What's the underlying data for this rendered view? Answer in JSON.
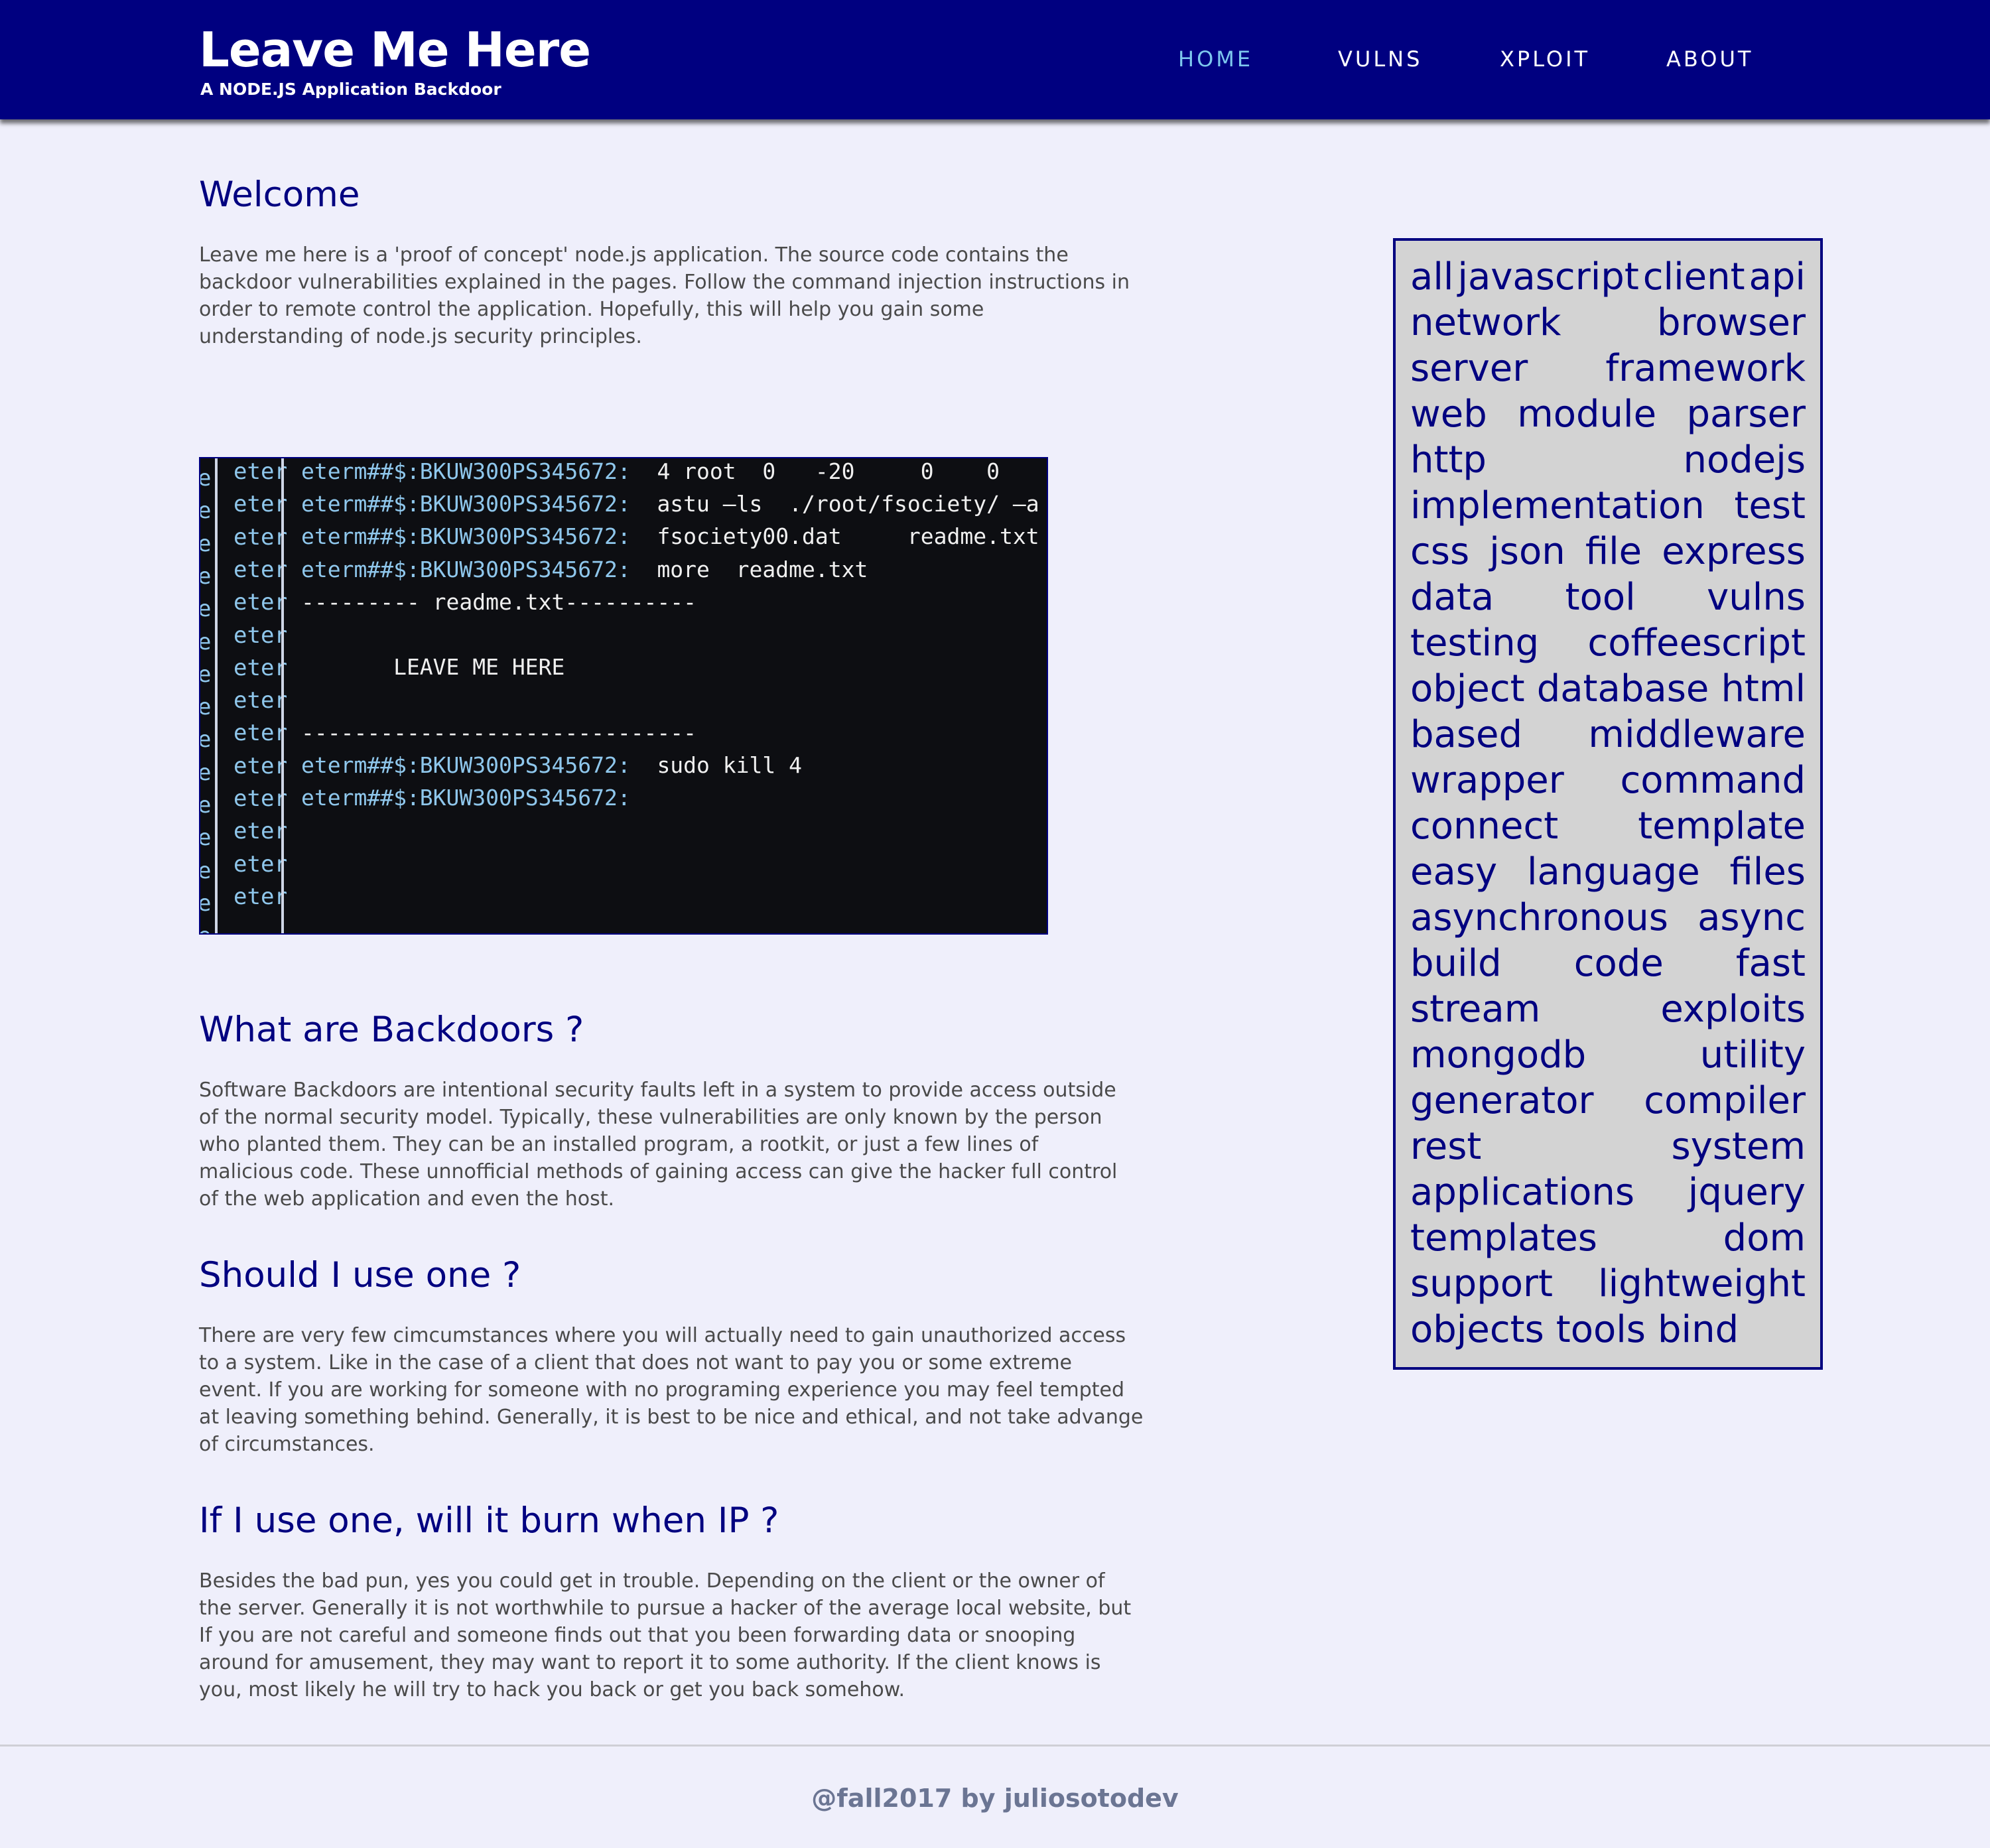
{
  "header": {
    "title": "Leave Me Here",
    "tagline": "A NODE.JS Application Backdoor",
    "nav": [
      {
        "label": "HOME",
        "active": true
      },
      {
        "label": "VULNS",
        "active": false
      },
      {
        "label": "XPLOIT",
        "active": false
      },
      {
        "label": "ABOUT",
        "active": false
      }
    ]
  },
  "main": {
    "welcome": {
      "heading": "Welcome",
      "lines": [
        "Leave me here is a 'proof of concept' node.js application. The source code contains the",
        "backdoor vulnerabilities explained in the pages. Follow the command injection instructions in",
        "order to remote control the application. Hopefully, this will help you gain some",
        "understanding of node.js security principles."
      ]
    },
    "backdoors": {
      "heading": "What are Backdoors ?",
      "lines": [
        "Software Backdoors are intentional security faults left in a system to provide access outside",
        "of the normal security model. Typically, these vulnerabilities are only known by the person",
        "who planted them. They can be an installed program, a rootkit, or just a few lines of",
        "malicious code. These unnofficial methods of gaining access can give the hacker full control",
        "of the web application and even the host."
      ]
    },
    "should_use": {
      "heading": "Should I use one ?",
      "lines": [
        "There are very few cimcumstances where you will actually need to gain unauthorized access",
        "to a system. Like in the case of a client that does not want to pay you or some extreme",
        "event. If you are working for someone with no programing experience you may feel tempted",
        "at leaving something behind. Generally, it is best to be nice and ethical, and not take advange",
        "of circumstances."
      ]
    },
    "burn": {
      "heading": "If I use one, will it burn when IP ?",
      "lines": [
        "Besides the bad pun, yes you could get in trouble. Depending on the client or the owner of",
        "the server. Generally it is not worthwhile to pursue a hacker of the average local website, but",
        "If you are not careful and someone finds out that you been forwarding data or snooping",
        "around for amusement, they may want to report it to some authority. If the client knows is",
        "you, most likely he will try to hack you back or get you back somehow."
      ]
    }
  },
  "terminal": {
    "gutter_left": "e",
    "gutter_word": "eter",
    "lines": [
      {
        "prompt": "eterm##$:BKUW300PS345672:",
        "text": "  4 root  0   -20     0    0"
      },
      {
        "prompt": "eterm##$:BKUW300PS345672:",
        "text": "  astu –ls  ./root/fsociety/ –a"
      },
      {
        "prompt": "eterm##$:BKUW300PS345672:",
        "text": "  fsociety00.dat     readme.txt"
      },
      {
        "prompt": "eterm##$:BKUW300PS345672:",
        "text": "  more  readme.txt"
      },
      {
        "prompt": "",
        "text": "--------- readme.txt----------"
      },
      {
        "prompt": "",
        "text": ""
      },
      {
        "prompt": "",
        "text": "       LEAVE ME HERE"
      },
      {
        "prompt": "",
        "text": ""
      },
      {
        "prompt": "",
        "text": "------------------------------"
      },
      {
        "prompt": "eterm##$:BKUW300PS345672:",
        "text": "  sudo kill 4"
      },
      {
        "prompt": "eterm##$:BKUW300PS345672:",
        "text": ""
      }
    ]
  },
  "tagcloud": {
    "rows": [
      [
        "all",
        "javascript",
        "client",
        "api"
      ],
      [
        "network",
        "browser"
      ],
      [
        "server",
        "framework"
      ],
      [
        "web",
        "module",
        "parser"
      ],
      [
        "http",
        "nodejs"
      ],
      [
        "implementation",
        "test"
      ],
      [
        "css",
        "json",
        "file",
        "express"
      ],
      [
        "data",
        "tool",
        "vulns"
      ],
      [
        "testing",
        "coffeescript"
      ],
      [
        "object",
        "database",
        "html"
      ],
      [
        "based",
        "middleware"
      ],
      [
        "wrapper",
        "command"
      ],
      [
        "connect",
        "template"
      ],
      [
        "easy",
        "language",
        "files"
      ],
      [
        "asynchronous",
        "async"
      ],
      [
        "build",
        "code",
        "fast"
      ],
      [
        "stream",
        "exploits"
      ],
      [
        "mongodb",
        "utility"
      ],
      [
        "generator",
        "compiler"
      ],
      [
        "rest",
        "system"
      ],
      [
        "applications",
        "jquery"
      ],
      [
        "templates",
        "dom"
      ],
      [
        "support",
        "lightweight"
      ],
      [
        "objects",
        "tools",
        "bind"
      ]
    ]
  },
  "footer": {
    "text": "@fall2017 by juliosotodev"
  },
  "colors": {
    "header_bg": "#000080",
    "page_bg": "#efeffb",
    "nav_active": "#7ec8ee",
    "heading": "#000080",
    "body_text": "#4a4a4a",
    "tagcloud_bg": "#d3d3d3",
    "footer_text": "#6b7593"
  }
}
